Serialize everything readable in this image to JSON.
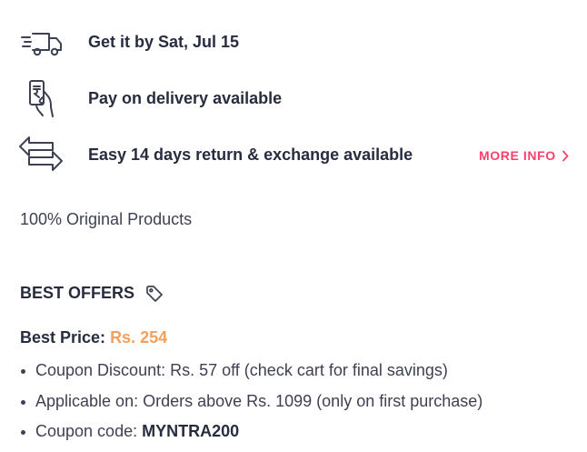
{
  "delivery": {
    "date_text": "Get it by Sat, Jul 15",
    "icon": "delivery-truck-icon"
  },
  "payment": {
    "text": "Pay on delivery available",
    "icon": "rupee-card-hand-icon"
  },
  "returns": {
    "text": "Easy 14 days return & exchange available",
    "icon": "return-exchange-arrows-icon",
    "more_info_label": "MORE INFO",
    "more_info_icon": "chevron-right-icon"
  },
  "original_products": "100% Original Products",
  "best_offers": {
    "title": "BEST OFFERS",
    "icon": "tag-icon",
    "best_price_label": "Best Price:",
    "best_price_value": "Rs. 254",
    "items": [
      {
        "text": "Coupon Discount: Rs. 57 off (check cart for final savings)"
      },
      {
        "text": "Applicable on: Orders above Rs. 1099 (only on first purchase)"
      },
      {
        "label": "Coupon code: ",
        "value": "MYNTRA200"
      }
    ]
  },
  "colors": {
    "accent": "#ff3f6c",
    "price": "#f5a05a",
    "text_dark": "#282c3f",
    "text_body": "#3e4152"
  }
}
